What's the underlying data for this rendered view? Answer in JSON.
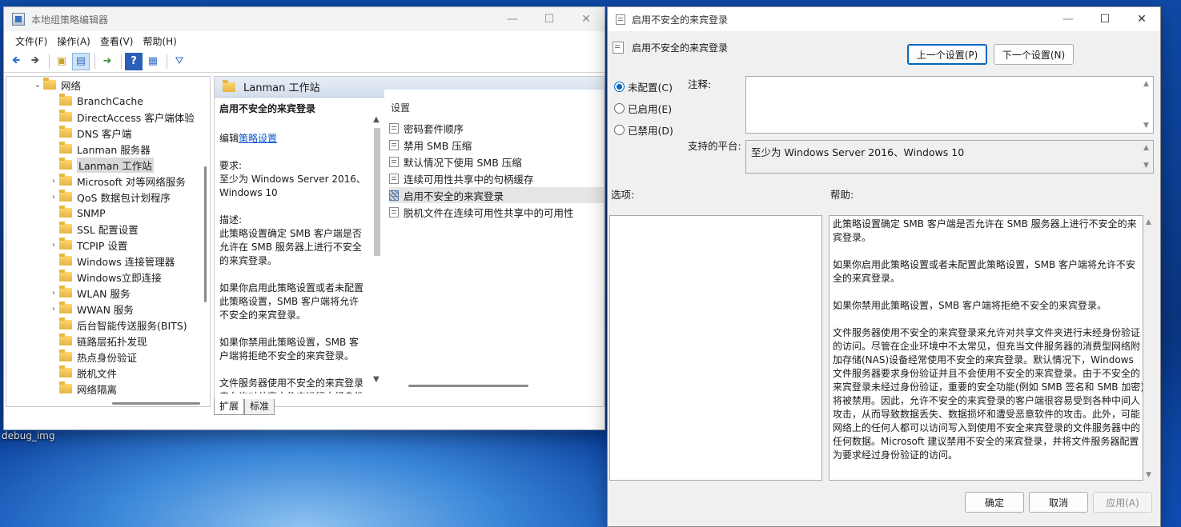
{
  "desktop": {
    "label": "debug_img"
  },
  "gpedit": {
    "title": "本地组策略编辑器",
    "menu": [
      "文件(F)",
      "操作(A)",
      "查看(V)",
      "帮助(H)"
    ],
    "tree": [
      {
        "label": "网络",
        "arrow": "⌄",
        "indent": 46
      },
      {
        "label": "BranchCache",
        "arrow": "",
        "indent": 66
      },
      {
        "label": "DirectAccess 客户端体验",
        "arrow": "",
        "indent": 66
      },
      {
        "label": "DNS 客户端",
        "arrow": "",
        "indent": 66
      },
      {
        "label": "Lanman 服务器",
        "arrow": "",
        "indent": 66
      },
      {
        "label": "Lanman 工作站",
        "arrow": "",
        "indent": 66,
        "selected": true
      },
      {
        "label": "Microsoft 对等网络服务",
        "arrow": "›",
        "indent": 66
      },
      {
        "label": "QoS 数据包计划程序",
        "arrow": "›",
        "indent": 66
      },
      {
        "label": "SNMP",
        "arrow": "",
        "indent": 66
      },
      {
        "label": "SSL 配置设置",
        "arrow": "",
        "indent": 66
      },
      {
        "label": "TCPIP 设置",
        "arrow": "›",
        "indent": 66
      },
      {
        "label": "Windows 连接管理器",
        "arrow": "",
        "indent": 66
      },
      {
        "label": "Windows立即连接",
        "arrow": "",
        "indent": 66
      },
      {
        "label": "WLAN 服务",
        "arrow": "›",
        "indent": 66
      },
      {
        "label": "WWAN 服务",
        "arrow": "›",
        "indent": 66
      },
      {
        "label": "后台智能传送服务(BITS)",
        "arrow": "",
        "indent": 66
      },
      {
        "label": "链路层拓扑发现",
        "arrow": "",
        "indent": 66
      },
      {
        "label": "热点身份验证",
        "arrow": "",
        "indent": 66
      },
      {
        "label": "脱机文件",
        "arrow": "",
        "indent": 66
      },
      {
        "label": "网络隔离",
        "arrow": "",
        "indent": 66
      }
    ],
    "right_header": "Lanman 工作站",
    "desc": {
      "heading": "启用不安全的来宾登录",
      "edit_prefix": "编辑",
      "edit_link": "策略设置",
      "req_label": "要求:",
      "req_value": "至少为 Windows Server 2016、Windows 10",
      "desc_label": "描述:",
      "p1": "此策略设置确定 SMB 客户端是否允许在 SMB 服务器上进行不安全的来宾登录。",
      "p2": "如果你启用此策略设置或者未配置此策略设置，SMB 客户端将允许不安全的来宾登录。",
      "p3": "如果你禁用此策略设置，SMB 客户端将拒绝不安全的来宾登录。",
      "p4": "文件服务器使用不安全的来宾登录来允许对共享文件夹进行未经身份验证的访问。"
    },
    "settings_header": "设置",
    "settings": [
      {
        "label": "密码套件顺序"
      },
      {
        "label": "禁用 SMB 压缩"
      },
      {
        "label": "默认情况下使用 SMB 压缩"
      },
      {
        "label": "连续可用性共享中的句柄缓存"
      },
      {
        "label": "启用不安全的来宾登录",
        "selected": true
      },
      {
        "label": "脱机文件在连续可用性共享中的可用性"
      }
    ],
    "tabs": [
      "扩展",
      "标准"
    ]
  },
  "dialog": {
    "title": "启用不安全的来宾登录",
    "heading": "启用不安全的来宾登录",
    "prev_btn": "上一个设置(P)",
    "next_btn": "下一个设置(N)",
    "radio_not_configured": "未配置(C)",
    "radio_enabled": "已启用(E)",
    "radio_disabled": "已禁用(D)",
    "comment_label": "注释:",
    "platform_label": "支持的平台:",
    "platform_value": "至少为 Windows Server 2016、Windows 10",
    "options_label": "选项:",
    "help_label": "帮助:",
    "help": {
      "p1": "此策略设置确定 SMB 客户端是否允许在 SMB 服务器上进行不安全的来宾登录。",
      "p2": "如果你启用此策略设置或者未配置此策略设置，SMB 客户端将允许不安全的来宾登录。",
      "p3": "如果你禁用此策略设置，SMB 客户端将拒绝不安全的来宾登录。",
      "p4": "文件服务器使用不安全的来宾登录来允许对共享文件夹进行未经身份验证的访问。尽管在企业环境中不太常见，但充当文件服务器的消费型网络附加存储(NAS)设备经常使用不安全的来宾登录。默认情况下，Windows 文件服务器要求身份验证并且不会使用不安全的来宾登录。由于不安全的来宾登录未经过身份验证，重要的安全功能(例如 SMB 签名和 SMB 加密)将被禁用。因此，允许不安全的来宾登录的客户端很容易受到各种中间人攻击，从而导致数据丢失、数据损坏和遭受恶意软件的攻击。此外，可能网络上的任何人都可以访问写入到使用不安全来宾登录的文件服务器中的任何数据。Microsoft 建议禁用不安全的来宾登录，并将文件服务器配置为要求经过身份验证的访问。"
    },
    "ok_btn": "确定",
    "cancel_btn": "取消",
    "apply_btn": "应用(A)"
  }
}
